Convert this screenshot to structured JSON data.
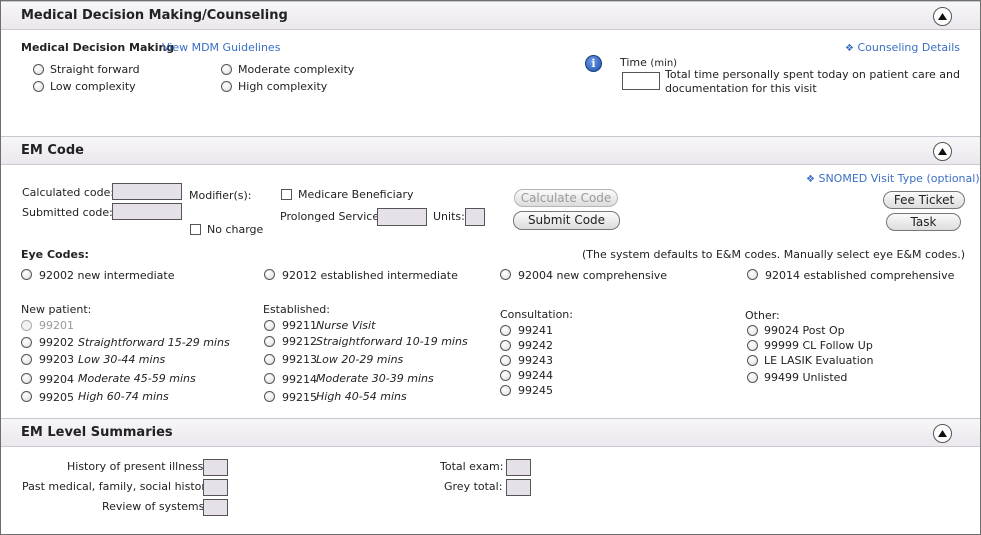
{
  "mdm_section": {
    "title": "Medical Decision Making/Counseling",
    "mdm_label": "Medical Decision Making",
    "mdm_link": "View MDM Guidelines",
    "counseling_link": "Counseling Details",
    "options": [
      "Straight forward",
      "Moderate complexity",
      "Low complexity",
      "High complexity"
    ],
    "time_label": "Time",
    "time_unit": "(min)",
    "time_desc_line1": "Total time personally spent today on patient care and",
    "time_desc_line2": "documentation for this visit"
  },
  "em_section": {
    "title": "EM Code",
    "calculated_label": "Calculated code:",
    "submitted_label": "Submitted code:",
    "modifiers_label": "Modifier(s):",
    "no_charge_label": "No charge",
    "medicare_label": "Medicare Beneficiary",
    "prolonged_label": "Prolonged Service:",
    "units_label": "Units:",
    "calculate_button": "Calculate Code",
    "submit_button": "Submit Code",
    "snomed_link": "SNOMED Visit Type (optional)",
    "fee_ticket_button": "Fee Ticket",
    "task_button": "Task",
    "eye_codes_label": "Eye Codes:",
    "eye_codes_note": "(The system defaults to E&M codes.  Manually select eye E&M codes.)",
    "eye_codes": [
      "92002 new intermediate",
      "92012 established intermediate",
      "92004 new comprehensive",
      "92014 established comprehensive"
    ],
    "new_patient": {
      "label": "New patient:",
      "items": [
        {
          "code": "99201",
          "desc": ""
        },
        {
          "code": "99202",
          "desc": "Straightforward 15-29 mins"
        },
        {
          "code": "99203",
          "desc": "Low 30-44 mins"
        },
        {
          "code": "99204",
          "desc": "Moderate 45-59 mins"
        },
        {
          "code": "99205",
          "desc": "High 60-74 mins"
        }
      ]
    },
    "established": {
      "label": "Established:",
      "items": [
        {
          "code": "99211",
          "desc": "Nurse Visit"
        },
        {
          "code": "99212",
          "desc": "Straightforward 10-19 mins"
        },
        {
          "code": "99213",
          "desc": "Low 20-29 mins"
        },
        {
          "code": "99214",
          "desc": "Moderate 30-39 mins"
        },
        {
          "code": "99215",
          "desc": "High 40-54 mins"
        }
      ]
    },
    "consultation": {
      "label": "Consultation:",
      "items": [
        "99241",
        "99242",
        "99243",
        "99244",
        "99245"
      ]
    },
    "other": {
      "label": "Other:",
      "items": [
        "99024 Post Op",
        "99999 CL Follow Up",
        "LE LASIK Evaluation",
        "99499 Unlisted"
      ]
    }
  },
  "summary_section": {
    "title": "EM Level Summaries",
    "hpi_label": "History of present illness:",
    "pmfsh_label": "Past medical, family, social history:",
    "ros_label": "Review of systems:",
    "total_exam_label": "Total exam:",
    "grey_total_label": "Grey total:"
  }
}
